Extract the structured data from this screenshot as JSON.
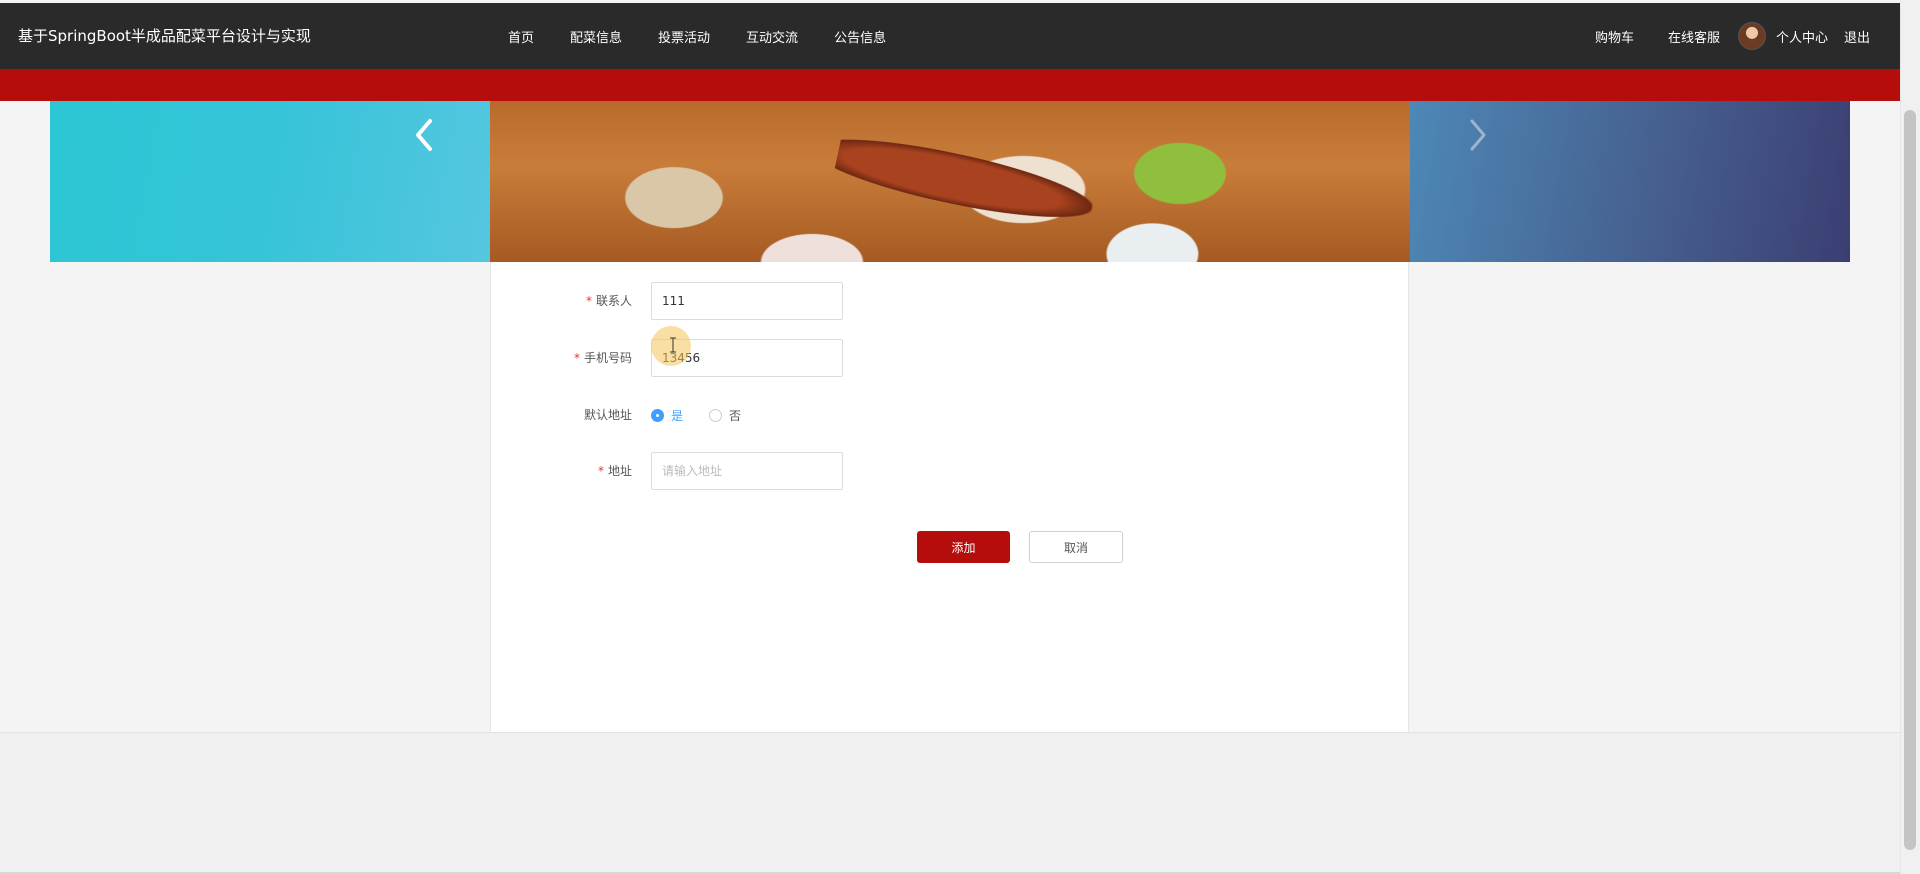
{
  "header": {
    "title": "基于SpringBoot半成品配菜平台设计与实现",
    "nav": [
      {
        "label": "首页"
      },
      {
        "label": "配菜信息"
      },
      {
        "label": "投票活动"
      },
      {
        "label": "互动交流"
      },
      {
        "label": "公告信息"
      }
    ],
    "right": {
      "cart": "购物车",
      "service": "在线客服",
      "user_center": "个人中心",
      "logout": "退出"
    }
  },
  "icons": {
    "carousel_prev": "chevron-left-icon",
    "carousel_next": "chevron-right-icon",
    "avatar": "user-avatar"
  },
  "form": {
    "contact": {
      "required_mark": "*",
      "label": "联系人",
      "value": "111"
    },
    "phone": {
      "required_mark": "*",
      "label": "手机号码",
      "value": "13456"
    },
    "default_address": {
      "label": "默认地址",
      "options": [
        {
          "label": "是",
          "checked": true
        },
        {
          "label": "否",
          "checked": false
        }
      ]
    },
    "address": {
      "required_mark": "*",
      "label": "地址",
      "placeholder": "请输入地址",
      "value": ""
    },
    "buttons": {
      "add": "添加",
      "cancel": "取消"
    }
  },
  "colors": {
    "navbar": "#2a2a2a",
    "accent_red": "#b50c0c",
    "radio_blue": "#409eff"
  }
}
